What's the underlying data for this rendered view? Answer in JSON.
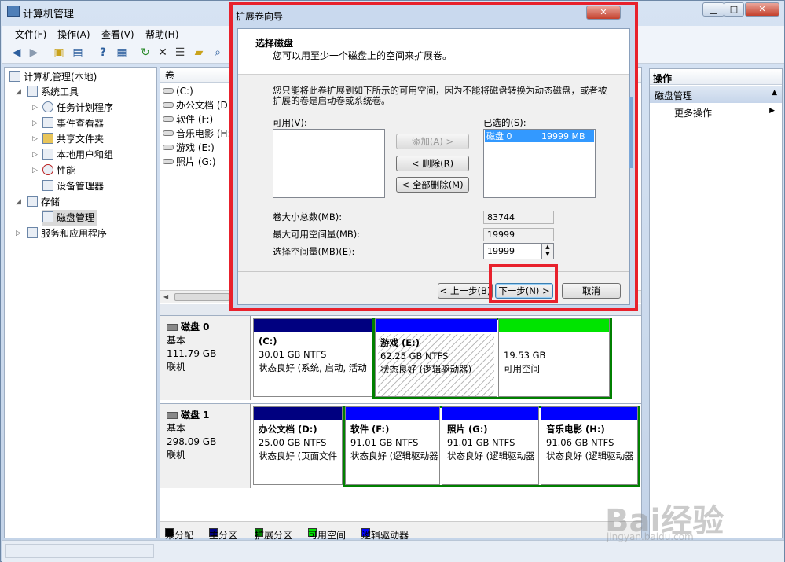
{
  "window": {
    "title": "计算机管理",
    "minimize": "▁",
    "maximize": "□",
    "close": "✕"
  },
  "menu": [
    "文件(F)",
    "操作(A)",
    "查看(V)",
    "帮助(H)"
  ],
  "toolbar_icons": [
    "back-arrow-icon",
    "forward-arrow-icon",
    "up-folder-icon",
    "show-hide-tree-icon",
    "help-icon",
    "console-view-icon",
    "refresh-icon",
    "delete-icon",
    "properties-icon",
    "open-folder-icon",
    "search-disk-icon",
    "disk-view-icon"
  ],
  "tree": {
    "root": "计算机管理(本地)",
    "items": [
      {
        "label": "系统工具",
        "level": 1,
        "expanded": true
      },
      {
        "label": "任务计划程序",
        "level": 2
      },
      {
        "label": "事件查看器",
        "level": 2
      },
      {
        "label": "共享文件夹",
        "level": 2
      },
      {
        "label": "本地用户和组",
        "level": 2
      },
      {
        "label": "性能",
        "level": 2
      },
      {
        "label": "设备管理器",
        "level": 2
      },
      {
        "label": "存储",
        "level": 1,
        "expanded": true
      },
      {
        "label": "磁盘管理",
        "level": 2,
        "selected": true
      },
      {
        "label": "服务和应用程序",
        "level": 1
      }
    ]
  },
  "volumes": {
    "header": "卷",
    "items": [
      "(C:)",
      "办公文档 (D:",
      "软件 (F:)",
      "音乐电影 (H:",
      "游戏 (E:)",
      "照片 (G:)"
    ]
  },
  "disks": [
    {
      "name": "磁盘 0",
      "type": "基本",
      "size": "111.79 GB",
      "status": "联机",
      "parts": [
        {
          "title": "(C:)",
          "size": "30.01 GB NTFS",
          "state": "状态良好 (系统, 启动, 活动"
        },
        {
          "title": "游戏 (E:)",
          "size": "62.25 GB NTFS",
          "state": "状态良好 (逻辑驱动器)"
        },
        {
          "title": "",
          "size": "19.53 GB",
          "state": "可用空间"
        }
      ]
    },
    {
      "name": "磁盘 1",
      "type": "基本",
      "size": "298.09 GB",
      "status": "联机",
      "parts": [
        {
          "title": "办公文档 (D:)",
          "size": "25.00 GB NTFS",
          "state": "状态良好 (页面文件"
        },
        {
          "title": "软件 (F:)",
          "size": "91.01 GB NTFS",
          "state": "状态良好 (逻辑驱动器"
        },
        {
          "title": "照片 (G:)",
          "size": "91.01 GB NTFS",
          "state": "状态良好 (逻辑驱动器"
        },
        {
          "title": "音乐电影 (H:)",
          "size": "91.06 GB NTFS",
          "state": "状态良好 (逻辑驱动器"
        }
      ]
    }
  ],
  "legend": [
    {
      "label": "未分配",
      "color": "#000000"
    },
    {
      "label": "主分区",
      "color": "#000080"
    },
    {
      "label": "扩展分区",
      "color": "#008000"
    },
    {
      "label": "可用空间",
      "color": "#00e400"
    },
    {
      "label": "逻辑驱动器",
      "color": "#0000ff"
    }
  ],
  "actions": {
    "header": "操作",
    "section": "磁盘管理",
    "more": "更多操作"
  },
  "dialog": {
    "title": "扩展卷向导",
    "heading": "选择磁盘",
    "subheading": "您可以用至少一个磁盘上的空间来扩展卷。",
    "description": "您只能将此卷扩展到如下所示的可用空间，因为不能将磁盘转换为动态磁盘，或者被扩展的卷是启动卷或系统卷。",
    "available_label": "可用(V):",
    "selected_label": "已选的(S):",
    "selected_items": [
      {
        "disk": "磁盘 0",
        "size": "19999 MB"
      }
    ],
    "add": "添加(A) >",
    "remove": "< 删除(R)",
    "remove_all": "< 全部删除(M)",
    "total_label": "卷大小总数(MB):",
    "total_value": "83744",
    "max_label": "最大可用空间量(MB):",
    "max_value": "19999",
    "select_label": "选择空间量(MB)(E):",
    "select_value": "19999",
    "back": "< 上一步(B)",
    "next": "下一步(N) >",
    "cancel": "取消",
    "close": "✕"
  },
  "watermark": {
    "text": "Bai经验",
    "sub": "jingyan.baidu.com"
  },
  "colors": {
    "primary": "#000080",
    "logical": "#0000ff",
    "free": "#00e400",
    "extended": "#008000",
    "highlight": "#e8212c"
  }
}
